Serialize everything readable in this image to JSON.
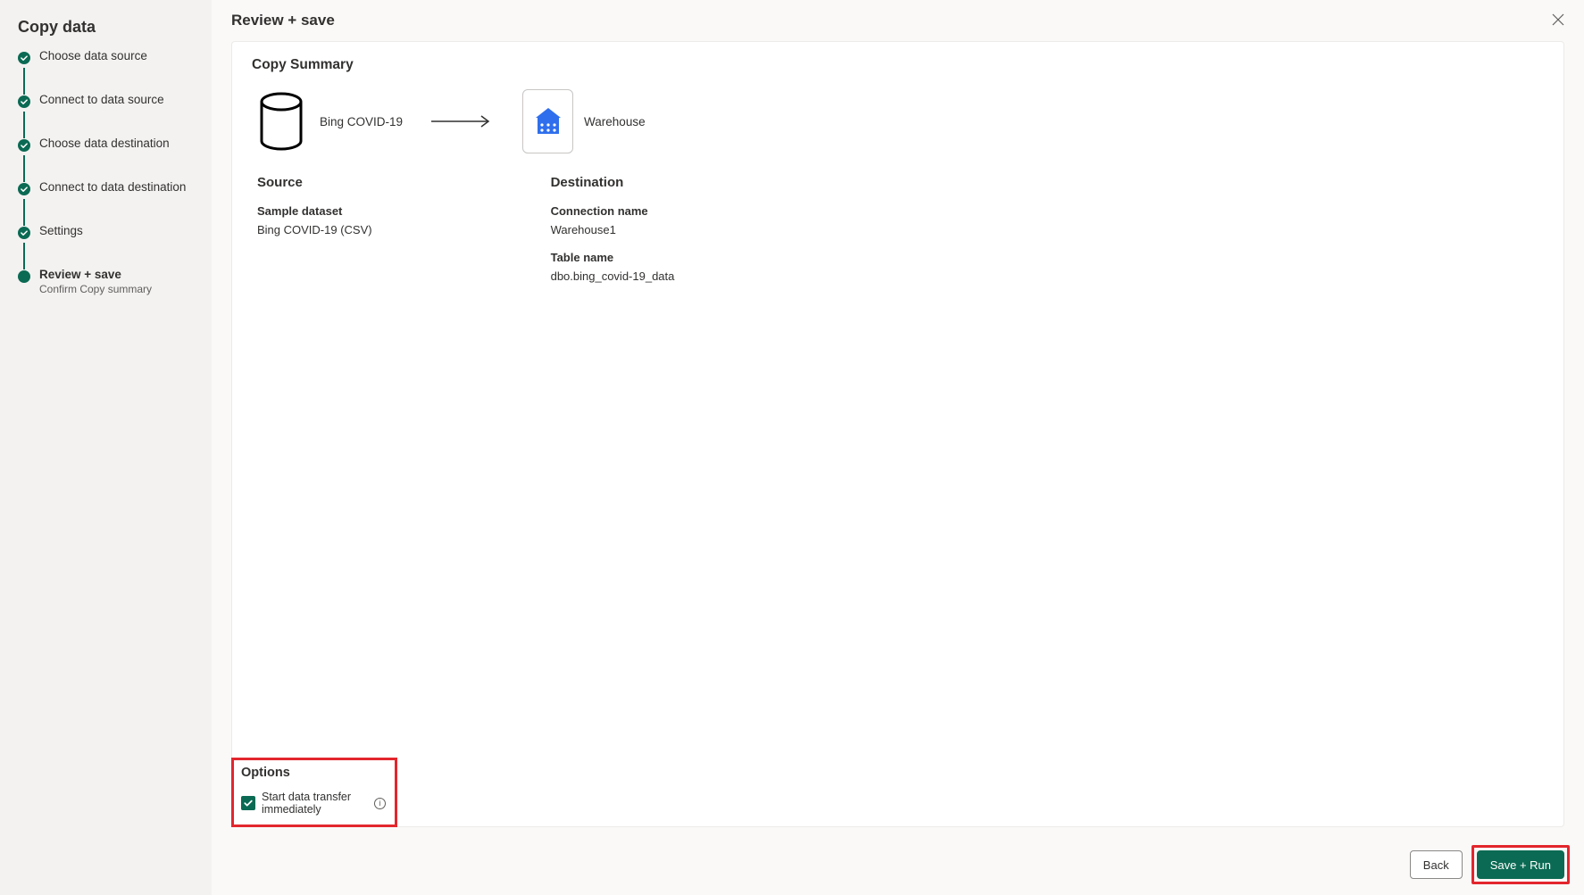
{
  "sidebar": {
    "title": "Copy data",
    "steps": [
      {
        "label": "Choose data source",
        "state": "complete"
      },
      {
        "label": "Connect to data source",
        "state": "complete"
      },
      {
        "label": "Choose data destination",
        "state": "complete"
      },
      {
        "label": "Connect to data destination",
        "state": "complete"
      },
      {
        "label": "Settings",
        "state": "complete"
      },
      {
        "label": "Review + save",
        "sublabel": "Confirm Copy summary",
        "state": "current"
      }
    ]
  },
  "header": {
    "title": "Review + save"
  },
  "summary": {
    "title": "Copy Summary",
    "source_name": "Bing COVID-19",
    "dest_name": "Warehouse",
    "source": {
      "heading": "Source",
      "sample_dataset_label": "Sample dataset",
      "sample_dataset_value": "Bing COVID-19 (CSV)"
    },
    "destination": {
      "heading": "Destination",
      "connection_name_label": "Connection name",
      "connection_name_value": "Warehouse1",
      "table_name_label": "Table name",
      "table_name_value": "dbo.bing_covid-19_data"
    }
  },
  "options": {
    "title": "Options",
    "start_transfer_label": "Start data transfer immediately",
    "start_transfer_checked": true
  },
  "footer": {
    "back_label": "Back",
    "save_run_label": "Save + Run"
  },
  "colors": {
    "accent": "#0b6a53",
    "highlight_box": "#e3262d",
    "destination_tile": "#2f6fed"
  }
}
